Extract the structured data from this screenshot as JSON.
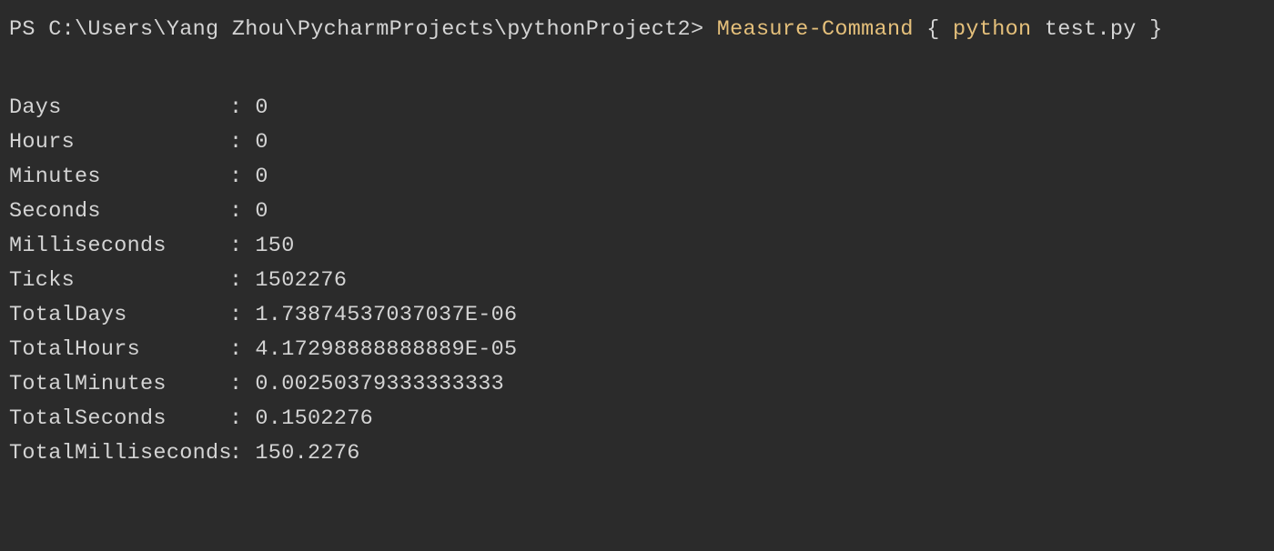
{
  "prompt": {
    "ps_prefix": "PS ",
    "path": "C:\\Users\\Yang Zhou\\PycharmProjects\\pythonProject2",
    "path_suffix": "> ",
    "cmd_measure": "Measure-Command",
    "cmd_brace_open": " { ",
    "cmd_python": "python",
    "cmd_file": " test.py ",
    "cmd_brace_close": "}"
  },
  "output": {
    "separator": ":",
    "rows": [
      {
        "label": "Days",
        "value": "0"
      },
      {
        "label": "Hours",
        "value": "0"
      },
      {
        "label": "Minutes",
        "value": "0"
      },
      {
        "label": "Seconds",
        "value": "0"
      },
      {
        "label": "Milliseconds",
        "value": "150"
      },
      {
        "label": "Ticks",
        "value": "1502276"
      },
      {
        "label": "TotalDays",
        "value": "1.73874537037037E-06"
      },
      {
        "label": "TotalHours",
        "value": "4.17298888888889E-05"
      },
      {
        "label": "TotalMinutes",
        "value": "0.00250379333333333"
      },
      {
        "label": "TotalSeconds",
        "value": "0.1502276"
      },
      {
        "label": "TotalMilliseconds",
        "value": "150.2276"
      }
    ]
  }
}
